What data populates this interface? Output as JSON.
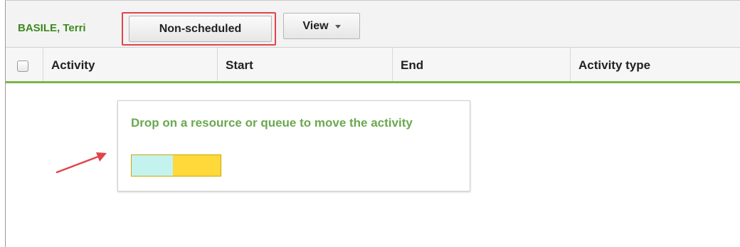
{
  "toolbar": {
    "resource_name": "BASILE, Terri",
    "nonscheduled_label": "Non-scheduled",
    "view_label": "View"
  },
  "table": {
    "columns": [
      "Activity",
      "Start",
      "End",
      "Activity type"
    ]
  },
  "drag_tooltip": {
    "message": "Drop on a resource or queue to move the activity"
  },
  "colors": {
    "resource_green": "#3c8a1e",
    "tooltip_text_green": "#6aa84f",
    "header_underline_green": "#7ab648",
    "highlight_red": "#e0454b",
    "chip_cyan": "#c4f3ef",
    "chip_yellow": "#ffd83a",
    "arrow_red": "#e0454b"
  },
  "icons": {
    "view_caret": "chevron-down-icon",
    "annotation_arrow": "arrow-icon"
  }
}
